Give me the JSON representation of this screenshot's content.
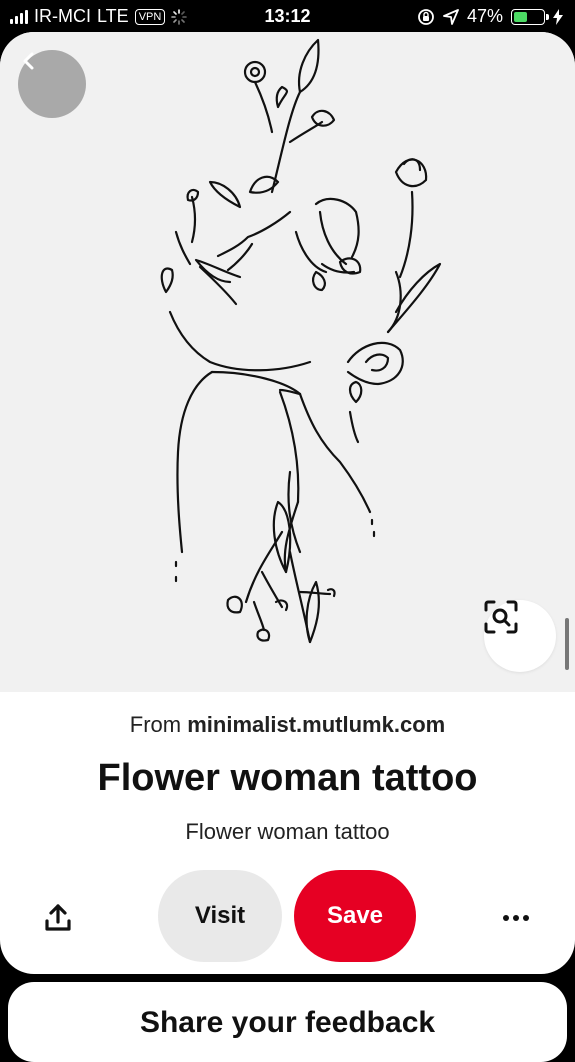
{
  "status_bar": {
    "carrier": "IR-MCI",
    "network": "LTE",
    "vpn": "VPN",
    "time": "13:12",
    "battery_percent": "47%",
    "battery_level": 0.47,
    "battery_color": "#4cd964"
  },
  "pin": {
    "source_prefix": "From",
    "source_domain": "minimalist.mutlumk.com",
    "title": "Flower woman tattoo",
    "description": "Flower woman tattoo"
  },
  "actions": {
    "visit_label": "Visit",
    "save_label": "Save",
    "save_color": "#e60023"
  },
  "icons": {
    "back": "chevron-left-icon",
    "lens": "visual-search-icon",
    "share": "share-icon",
    "more": "more-icon"
  },
  "feedback": {
    "title": "Share your feedback"
  }
}
